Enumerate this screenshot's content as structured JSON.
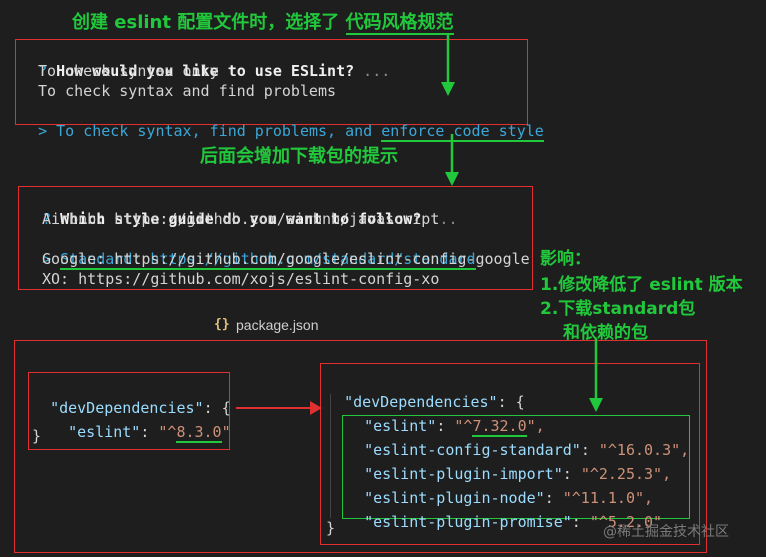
{
  "annotations": {
    "top_title_prefix": "创建 eslint 配置文件时，选择了",
    "top_title_highlight": "代码风格规范",
    "middle_note": "后面会增加下载包的提示",
    "impact_title": "影响：",
    "impact_1": "1.修改降低了 eslint 版本",
    "impact_2": "2.下载standard包",
    "impact_3": "和依赖的包"
  },
  "prompt1": {
    "marker": "?",
    "question": "How would you like to use ESLint?",
    "ellipsis": "...",
    "options": [
      "To check syntax only",
      "To check syntax and find problems"
    ],
    "selected_marker": ">",
    "selected_prefix": "To check syntax, find problems, and ",
    "selected_highlight": "enforce code style"
  },
  "prompt2": {
    "marker": "?",
    "question": "Which style guide do you want to follow?",
    "ellipsis": "...",
    "option_airbnb": "Airbnb: https://github.com/airbnb/javascript",
    "selected_marker": ">",
    "selected_option": "Standard: https://github.com/standard/standard",
    "option_google": "Google: https://github.com/google/eslint-config-google",
    "option_xo": "XO: https://github.com/xojs/eslint-config-xo"
  },
  "tab": {
    "icon": "{}",
    "filename": "package.json"
  },
  "before": {
    "key": "\"devDependencies\"",
    "colon_brace": ": {",
    "pkg_key": "\"eslint\"",
    "pkg_val_prefix": "\"^",
    "pkg_val_highlight": "8.3.0",
    "pkg_val_suffix": "\"",
    "close": "}"
  },
  "after": {
    "key": "\"devDependencies\"",
    "colon_brace": ": {",
    "eslint_key": "\"eslint\"",
    "eslint_val_prefix": "\"^",
    "eslint_val_highlight": "7.32.0",
    "eslint_val_suffix": "\",",
    "deps": [
      {
        "key": "\"eslint-config-standard\"",
        "val": "\"^16.0.3\","
      },
      {
        "key": "\"eslint-plugin-import\"",
        "val": "\"^2.25.3\","
      },
      {
        "key": "\"eslint-plugin-node\"",
        "val": "\"^11.1.0\","
      },
      {
        "key": "\"eslint-plugin-promise\"",
        "val": "\"^5.2.0\""
      }
    ],
    "close": "}"
  },
  "watermark": "@稀土掘金技术社区",
  "colors": {
    "annotation_green": "#22c83c",
    "box_red": "#e03030",
    "prompt_cyan": "#3aa7d8"
  }
}
